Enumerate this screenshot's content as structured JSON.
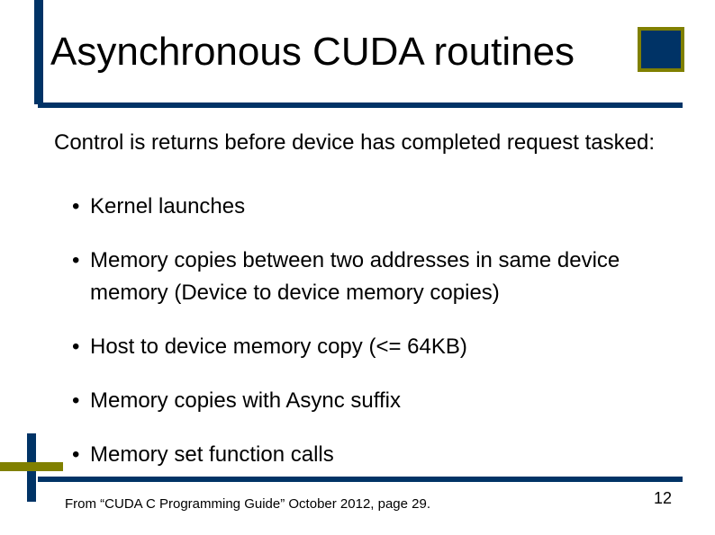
{
  "title": "Asynchronous CUDA routines",
  "intro": "Control is returns before device has completed request tasked:",
  "bullets": [
    "Kernel launches",
    "Memory copies between two addresses in same device memory (Device to device memory copies)",
    "Host to device memory copy (<= 64KB)",
    "Memory copies with Async suffix",
    "Memory set function calls"
  ],
  "citation": "From “CUDA C Programming Guide” October 2012, page 29.",
  "page_number": "12"
}
